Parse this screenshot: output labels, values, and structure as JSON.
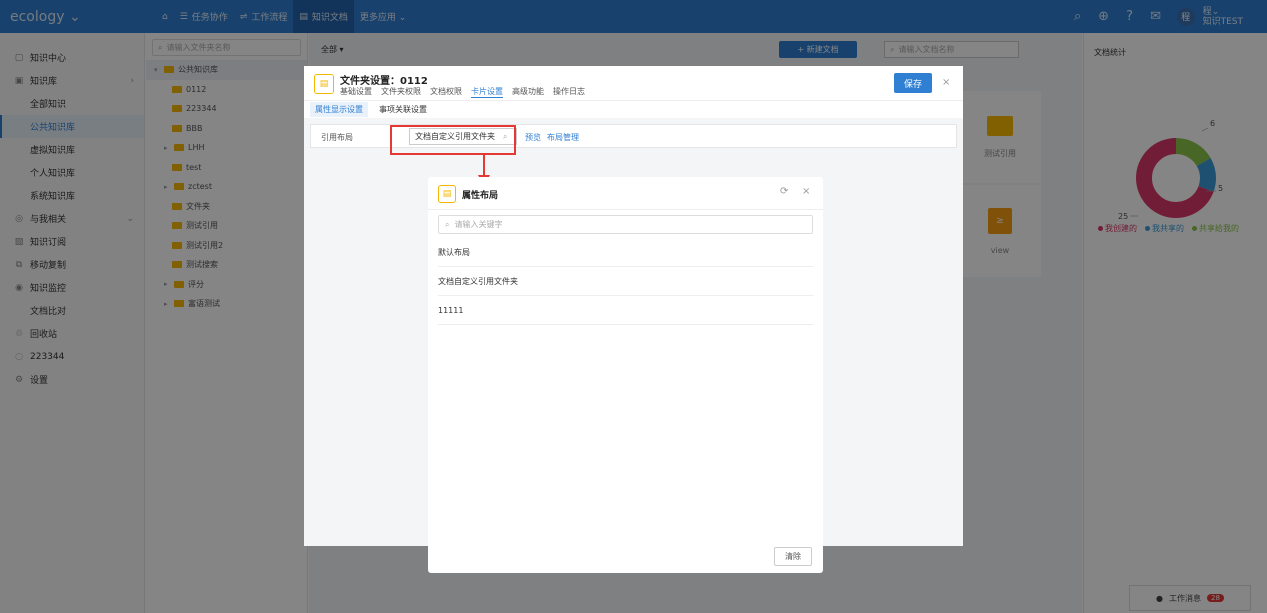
{
  "topbar": {
    "brand": "ecology ⌄",
    "nav": [
      {
        "label": "任务协作",
        "icon": "list-icon"
      },
      {
        "label": "工作流程",
        "icon": "flow-icon"
      },
      {
        "label": "知识文档",
        "icon": "doc-icon",
        "active": true
      },
      {
        "label": "更多应用 ⌄",
        "icon": ""
      }
    ],
    "avatar_text": "程",
    "user_name": "程⌄",
    "user_sub": "知识TEST"
  },
  "leftmenu": [
    {
      "label": "知识中心",
      "icon": "doc-icon",
      "level": 0
    },
    {
      "label": "知识库",
      "icon": "library-icon",
      "level": 0,
      "arrow": "›"
    },
    {
      "label": "全部知识",
      "level": 1
    },
    {
      "label": "公共知识库",
      "level": 1,
      "active": true
    },
    {
      "label": "虚拟知识库",
      "level": 1
    },
    {
      "label": "个人知识库",
      "level": 1
    },
    {
      "label": "系统知识库",
      "level": 1
    },
    {
      "label": "与我相关",
      "icon": "link-icon",
      "level": 0,
      "arrow": "⌄"
    },
    {
      "label": "知识订阅",
      "icon": "subscribe-icon",
      "level": 0
    },
    {
      "label": "移动复制",
      "icon": "copy-icon",
      "level": 0
    },
    {
      "label": "知识监控",
      "icon": "monitor-icon",
      "level": 0
    },
    {
      "label": "文档比对",
      "level": 1
    },
    {
      "label": "回收站",
      "icon": "trash-icon",
      "level": 0
    },
    {
      "label": "223344",
      "icon": "settings-icon",
      "level": 0
    },
    {
      "label": "设置",
      "icon": "gear-icon",
      "level": 0
    }
  ],
  "tree": {
    "search_placeholder": "请输入文件夹名称",
    "root": "公共知识库",
    "nodes": [
      {
        "label": "0112",
        "expandable": false
      },
      {
        "label": "223344",
        "expandable": false
      },
      {
        "label": "BBB",
        "expandable": false
      },
      {
        "label": "LHH",
        "expandable": true
      },
      {
        "label": "test",
        "expandable": false
      },
      {
        "label": "zctest",
        "expandable": true
      },
      {
        "label": "文件夹",
        "expandable": false
      },
      {
        "label": "测试引用",
        "expandable": false
      },
      {
        "label": "测试引用2",
        "expandable": false
      },
      {
        "label": "测试搜索",
        "expandable": false
      },
      {
        "label": "评分",
        "expandable": true
      },
      {
        "label": "富语测试",
        "expandable": true
      }
    ]
  },
  "main": {
    "filter": "全部 ▾",
    "new_doc": "+ 新建文档",
    "search_placeholder": "请输入文档名称",
    "cards": [
      {
        "label": "测试引用",
        "type": "folder"
      },
      {
        "label": "view",
        "type": "doc"
      }
    ]
  },
  "rightpanel": {
    "title": "文档统计",
    "chart_data": {
      "type": "pie",
      "slices": [
        {
          "name": "我创建的",
          "value": 25,
          "color": "#d9386a"
        },
        {
          "name": "我共享的",
          "value": 5,
          "color": "#3a9bd9"
        },
        {
          "name": "共享给我的",
          "value": 6,
          "color": "#8bc34a"
        }
      ]
    },
    "msg_label": "工作消息",
    "msg_count": "28"
  },
  "settings": {
    "icon": "📄",
    "title": "文件夹设置：0112",
    "tabs": [
      "基础设置",
      "文件夹权限",
      "文档权限",
      "卡片设置",
      "高级功能",
      "操作日志"
    ],
    "active_tab": 3,
    "save": "保存",
    "close": "×",
    "subtabs": [
      "属性显示设置",
      "事项关联设置"
    ],
    "layout_label": "引用布局",
    "layout_value": "文档自定义引用文件夹",
    "preview": "预览",
    "layout_manage": "布局管理"
  },
  "popup": {
    "title": "属性布局",
    "refresh": "⟳",
    "close": "×",
    "search_placeholder": "请输入关键字",
    "items": [
      "默认布局",
      "文档自定义引用文件夹",
      "11111"
    ],
    "clear": "清除"
  },
  "colors": {
    "primary": "#2f7fd2",
    "folder": "#f5b800",
    "highlight": "#e53935"
  }
}
